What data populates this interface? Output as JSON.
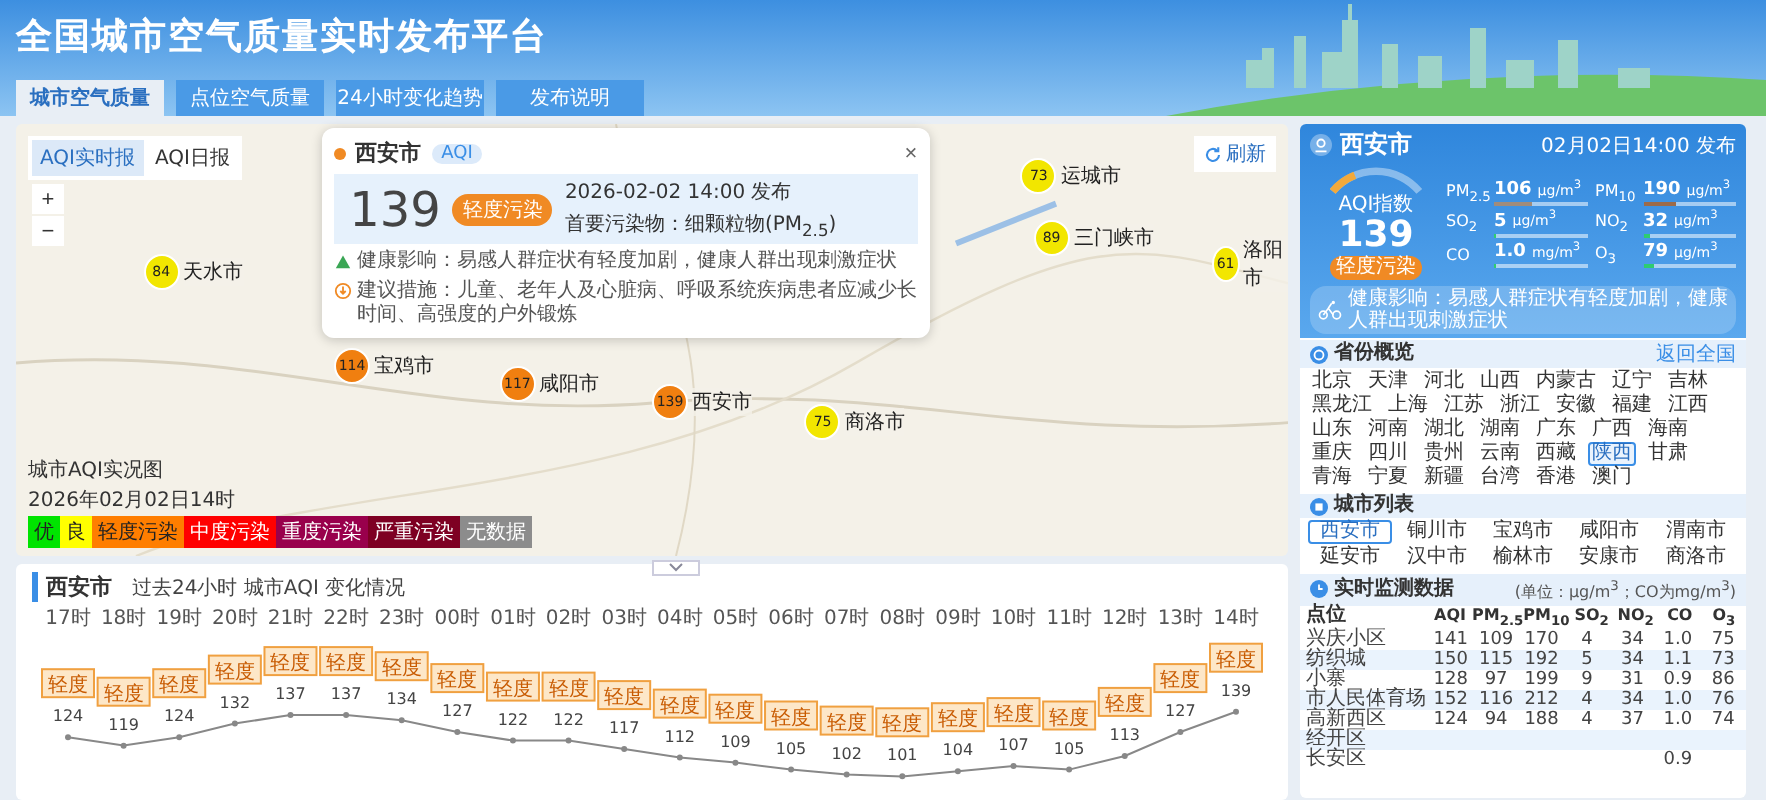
{
  "header": {
    "title": "全国城市空气质量实时发布平台"
  },
  "tabs": [
    {
      "label": "城市空气质量",
      "selected": true
    },
    {
      "label": "点位空气质量",
      "selected": false
    },
    {
      "label": "24小时变化趋势",
      "selected": false
    },
    {
      "label": "发布说明",
      "selected": false
    }
  ],
  "map": {
    "modes": [
      {
        "label": "AQI实时报",
        "selected": true
      },
      {
        "label": "AQI日报",
        "selected": false
      }
    ],
    "zoom_in": "+",
    "zoom_out": "−",
    "refresh": "刷新",
    "markers": [
      {
        "aqi": "84",
        "city": "天水市",
        "color": "#f2e600"
      },
      {
        "aqi": "114",
        "city": "宝鸡市",
        "color": "#f07f10"
      },
      {
        "aqi": "117",
        "city": "咸阳市",
        "color": "#f07f10"
      },
      {
        "aqi": "139",
        "city": "西安市",
        "color": "#f07f10"
      },
      {
        "aqi": "73",
        "city": "运城市",
        "color": "#f2e600"
      },
      {
        "aqi": "89",
        "city": "三门峡市",
        "color": "#f2e600"
      },
      {
        "aqi": "61",
        "city": "洛阳市",
        "color": "#f2e600"
      },
      {
        "aqi": "75",
        "city": "商洛市",
        "color": "#f2e600"
      }
    ],
    "legend_title": "城市AQI实况图",
    "legend_time": "2026年02月02日14时",
    "legend": [
      {
        "label": "优",
        "color": "#00e400"
      },
      {
        "label": "良",
        "color": "#ffff00"
      },
      {
        "label": "轻度污染",
        "color": "#ff7e00"
      },
      {
        "label": "中度污染",
        "color": "#ff0000"
      },
      {
        "label": "重度污染",
        "color": "#99004c"
      },
      {
        "label": "严重污染",
        "color": "#7e0023"
      },
      {
        "label": "无数据",
        "color": "#8c8c8c"
      }
    ],
    "popup": {
      "city": "西安市",
      "tag": "AQI",
      "close": "×",
      "aqi": "139",
      "category": "轻度污染",
      "time": "2026-02-02 14:00 发布",
      "primary": "首要污染物：细颗粒物(PM$_{2.5}$)",
      "health": "健康影响：易感人群症状有轻度加剧，健康人群出现刺激症状",
      "advice": "建议措施：儿童、老年人及心脏病、呼吸系统疾病患者应减少长时间、高强度的户外锻炼"
    }
  },
  "city_card": {
    "city": "西安市",
    "time": "02月02日14:00 发布",
    "gauge_label": "AQI指数",
    "aqi": "139",
    "category": "轻度污染",
    "gauge": {
      "level": 0.28
    },
    "pollutants": [
      {
        "name": "PM$_{2.5}$",
        "value": "106",
        "unit": "μg/m$^{3}$",
        "level": 0.4,
        "color": "#a08c7c"
      },
      {
        "name": "PM$_{10}$",
        "value": "190",
        "unit": "μg/m$^{3}$",
        "level": 0.35,
        "color": "#9c6b4a"
      },
      {
        "name": "SO$_{2}$",
        "value": "5",
        "unit": "μg/m$^{3}$",
        "level": 0.02,
        "color": "#2ecc71"
      },
      {
        "name": "NO$_{2}$",
        "value": "32",
        "unit": "μg/m$^{3}$",
        "level": 0.08,
        "color": "#2ecc71"
      },
      {
        "name": "CO",
        "value": "1.0",
        "unit": "mg/m$^{3}$",
        "level": 0.02,
        "color": "#2ecc71"
      },
      {
        "name": "O$_{3}$",
        "value": "79",
        "unit": "μg/m$^{3}$",
        "level": 0.12,
        "color": "#2ecc71"
      }
    ],
    "health": "健康影响：易感人群症状有轻度加剧，健康人群出现刺激症状"
  },
  "provinces": {
    "title": "省份概览",
    "back": "返回全国",
    "items": [
      {
        "label": "北京",
        "selected": false
      },
      {
        "label": "天津",
        "selected": false
      },
      {
        "label": "河北",
        "selected": false
      },
      {
        "label": "山西",
        "selected": false
      },
      {
        "label": "内蒙古",
        "selected": false
      },
      {
        "label": "辽宁",
        "selected": false
      },
      {
        "label": "吉林",
        "selected": false
      },
      {
        "label": "黑龙江",
        "selected": false
      },
      {
        "label": "上海",
        "selected": false
      },
      {
        "label": "江苏",
        "selected": false
      },
      {
        "label": "浙江",
        "selected": false
      },
      {
        "label": "安徽",
        "selected": false
      },
      {
        "label": "福建",
        "selected": false
      },
      {
        "label": "江西",
        "selected": false
      },
      {
        "label": "山东",
        "selected": false
      },
      {
        "label": "河南",
        "selected": false
      },
      {
        "label": "湖北",
        "selected": false
      },
      {
        "label": "湖南",
        "selected": false
      },
      {
        "label": "广东",
        "selected": false
      },
      {
        "label": "广西",
        "selected": false
      },
      {
        "label": "海南",
        "selected": false
      },
      {
        "label": "重庆",
        "selected": false
      },
      {
        "label": "四川",
        "selected": false
      },
      {
        "label": "贵州",
        "selected": false
      },
      {
        "label": "云南",
        "selected": false
      },
      {
        "label": "西藏",
        "selected": false
      },
      {
        "label": "陕西",
        "selected": true
      },
      {
        "label": "甘肃",
        "selected": false
      },
      {
        "label": "青海",
        "selected": false
      },
      {
        "label": "宁夏",
        "selected": false
      },
      {
        "label": "新疆",
        "selected": false
      },
      {
        "label": "台湾",
        "selected": false
      },
      {
        "label": "香港",
        "selected": false
      },
      {
        "label": "澳门",
        "selected": false
      }
    ]
  },
  "cities": {
    "title": "城市列表",
    "items": [
      {
        "label": "西安市",
        "selected": true
      },
      {
        "label": "铜川市",
        "selected": false
      },
      {
        "label": "宝鸡市",
        "selected": false
      },
      {
        "label": "咸阳市",
        "selected": false
      },
      {
        "label": "渭南市",
        "selected": false
      },
      {
        "label": "延安市",
        "selected": false
      },
      {
        "label": "汉中市",
        "selected": false
      },
      {
        "label": "榆林市",
        "selected": false
      },
      {
        "label": "安康市",
        "selected": false
      },
      {
        "label": "商洛市",
        "selected": false
      }
    ]
  },
  "stations": {
    "title": "实时监测数据",
    "unit_note": "(单位：μg/m$^{3}$；CO为mg/m$^{3}$)",
    "columns": [
      "点位",
      "AQI",
      "PM$_{2.5}$",
      "PM$_{10}$",
      "SO$_{2}$",
      "NO$_{2}$",
      "CO",
      "O$_{3}$"
    ],
    "rows": [
      [
        "兴庆小区",
        "141",
        "109",
        "170",
        "4",
        "34",
        "1.0",
        "75"
      ],
      [
        "纺织城",
        "150",
        "115",
        "192",
        "5",
        "34",
        "1.1",
        "73"
      ],
      [
        "小寨",
        "128",
        "97",
        "199",
        "9",
        "31",
        "0.9",
        "86"
      ],
      [
        "市人民体育场",
        "152",
        "116",
        "212",
        "4",
        "34",
        "1.0",
        "76"
      ],
      [
        "高新西区",
        "124",
        "94",
        "188",
        "4",
        "37",
        "1.0",
        "74"
      ],
      [
        "经开区",
        null,
        null,
        null,
        null,
        null,
        null,
        null
      ],
      [
        "长安区",
        null,
        null,
        null,
        null,
        null,
        "0.9",
        null
      ]
    ]
  },
  "trend": {
    "city": "西安市",
    "title": "过去24小时 城市AQI 变化情况",
    "tags": [
      "轻度",
      "轻度",
      "轻度",
      "轻度",
      "轻度",
      "轻度",
      "轻度",
      "轻度",
      "轻度",
      "轻度",
      "轻度",
      "轻度",
      "轻度",
      "轻度",
      "轻度",
      "轻度",
      "轻度",
      "轻度",
      "轻度",
      "轻度",
      "轻度",
      "轻度"
    ],
    "chart_data": {
      "type": "line",
      "categories": [
        "17时",
        "18时",
        "19时",
        "20时",
        "21时",
        "22时",
        "23时",
        "00时",
        "01时",
        "02时",
        "03时",
        "04时",
        "05时",
        "06时",
        "07时",
        "08时",
        "09时",
        "10时",
        "11时",
        "12时",
        "13时",
        "14时"
      ],
      "series": [
        {
          "color": "#888888",
          "marker": "circle",
          "values": [
            124,
            119,
            124,
            132,
            137,
            137,
            134,
            127,
            122,
            122,
            117,
            112,
            109,
            105,
            102,
            101,
            104,
            107,
            105,
            113,
            127,
            139
          ]
        }
      ],
      "data_labels": true
    }
  }
}
